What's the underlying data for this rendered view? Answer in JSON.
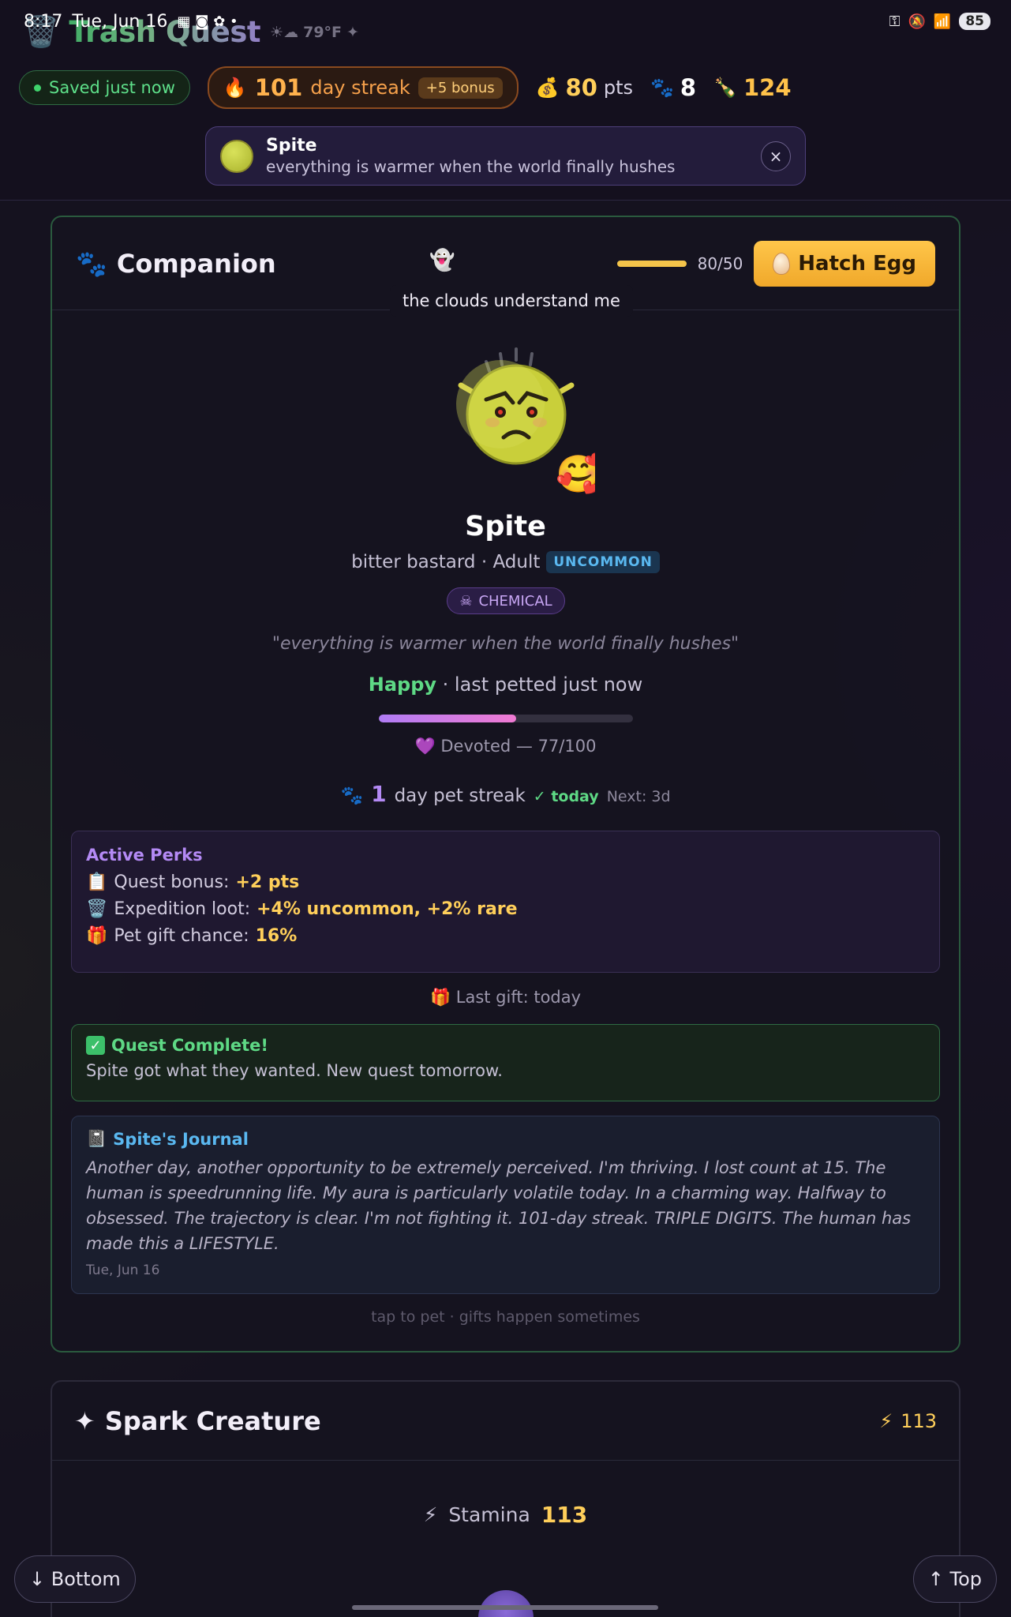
{
  "status_bar": {
    "time": "8:17",
    "date": "Tue, Jun 16",
    "battery": "85"
  },
  "header": {
    "app_title": "Trash Quest",
    "weather": "79°F",
    "saved": "Saved just now",
    "streak_num": "101",
    "streak_label": "day streak",
    "streak_bonus": "+5 bonus",
    "points": "80",
    "points_label": "pts",
    "paws": "8",
    "bottles": "124"
  },
  "toast": {
    "name": "Spite",
    "message": "everything is warmer when the world finally hushes",
    "close": "×"
  },
  "companion": {
    "title": "Companion",
    "xp": "80/50",
    "xp_progress": 1.0,
    "hatch_label": "Hatch Egg",
    "tooltip": "the clouds understand me",
    "pet_name": "Spite",
    "pet_desc": "bitter bastard · Adult",
    "rarity": "UNCOMMON",
    "type": "CHEMICAL",
    "quote": "\"everything is warmer when the world finally hushes\"",
    "mood": "Happy",
    "mood_detail": "· last petted just now",
    "bond_level": 0.54,
    "bond_text": "Devoted — 77/100",
    "pet_streak_num": "1",
    "pet_streak_label": "day pet streak",
    "pet_streak_today": "✓ today",
    "pet_streak_next": "Next: 3d",
    "perks": {
      "title": "Active Perks",
      "items": [
        {
          "icon": "📋",
          "label": "Quest bonus:",
          "value": "+2 pts"
        },
        {
          "icon": "🗑️",
          "label": "Expedition loot:",
          "value": "+4% uncommon, +2% rare"
        },
        {
          "icon": "🎁",
          "label": "Pet gift chance:",
          "value": "16%"
        }
      ]
    },
    "last_gift": "🎁 Last gift: today",
    "quest": {
      "title": "Quest Complete!",
      "text": "Spite got what they wanted. New quest tomorrow."
    },
    "journal": {
      "title": "Spite's Journal",
      "body": "Another day, another opportunity to be extremely perceived. I'm thriving. I lost count at 15. The human is speedrunning life. My aura is particularly volatile today. In a charming way. Halfway to obsessed. The trajectory is clear. I'm not fighting it. 101-day streak. TRIPLE DIGITS. The human has made this a LIFESTYLE.",
      "date": "Tue, Jun 16"
    },
    "tap_hint": "tap to pet · gifts happen sometimes"
  },
  "spark": {
    "title": "Spark Creature",
    "value": "113",
    "stamina_label": "Stamina",
    "stamina_value": "113"
  },
  "nav": {
    "bottom": "↓ Bottom",
    "top": "↑ Top"
  }
}
